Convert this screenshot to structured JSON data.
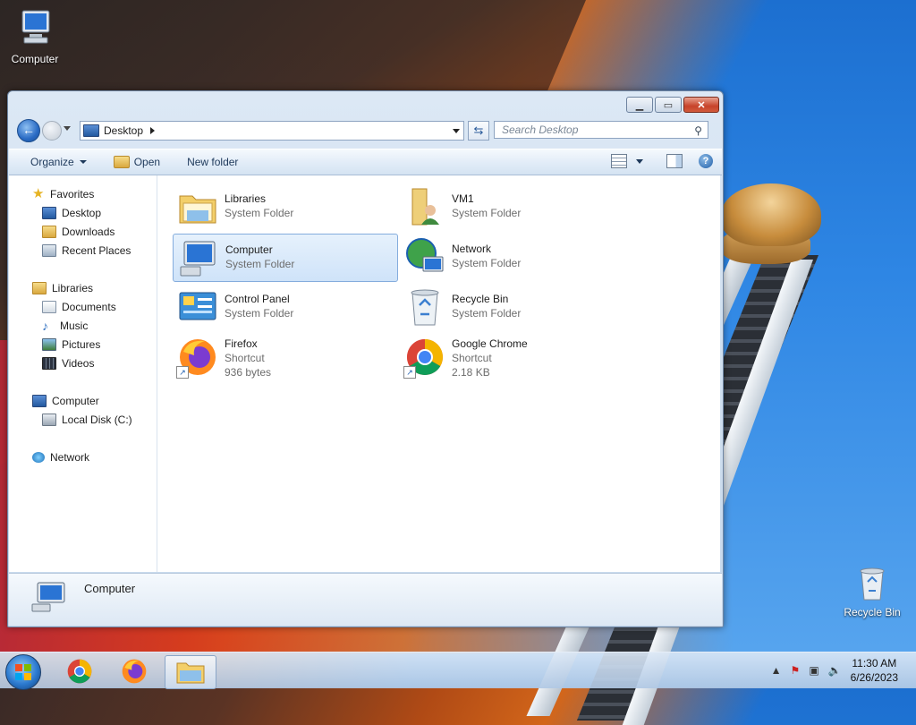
{
  "desktop": {
    "icons": [
      {
        "label": "Computer"
      },
      {
        "label": "Recycle Bin"
      }
    ]
  },
  "window": {
    "address": {
      "location": "Desktop"
    },
    "search": {
      "placeholder": "Search Desktop"
    },
    "toolbar": {
      "organize": "Organize",
      "open": "Open",
      "new_folder": "New folder"
    },
    "nav": {
      "favorites": {
        "label": "Favorites",
        "items": [
          "Desktop",
          "Downloads",
          "Recent Places"
        ]
      },
      "libraries": {
        "label": "Libraries",
        "items": [
          "Documents",
          "Music",
          "Pictures",
          "Videos"
        ]
      },
      "computer": {
        "label": "Computer",
        "items": [
          "Local Disk (C:)"
        ]
      },
      "network": {
        "label": "Network"
      }
    },
    "items": [
      {
        "name": "Libraries",
        "type": "System Folder",
        "icon": "libraries-icon"
      },
      {
        "name": "VM1",
        "type": "System Folder",
        "icon": "user-folder-icon"
      },
      {
        "name": "Computer",
        "type": "System Folder",
        "icon": "computer-icon",
        "selected": true
      },
      {
        "name": "Network",
        "type": "System Folder",
        "icon": "network-icon"
      },
      {
        "name": "Control Panel",
        "type": "System Folder",
        "icon": "control-panel-icon"
      },
      {
        "name": "Recycle Bin",
        "type": "System Folder",
        "icon": "recycle-bin-icon"
      },
      {
        "name": "Firefox",
        "type": "Shortcut",
        "size": "936 bytes",
        "icon": "firefox-icon"
      },
      {
        "name": "Google Chrome",
        "type": "Shortcut",
        "size": "2.18 KB",
        "icon": "chrome-icon"
      }
    ],
    "details": {
      "label": "Computer"
    }
  },
  "taskbar": {
    "clock": {
      "time": "11:30 AM",
      "date": "6/26/2023"
    }
  }
}
